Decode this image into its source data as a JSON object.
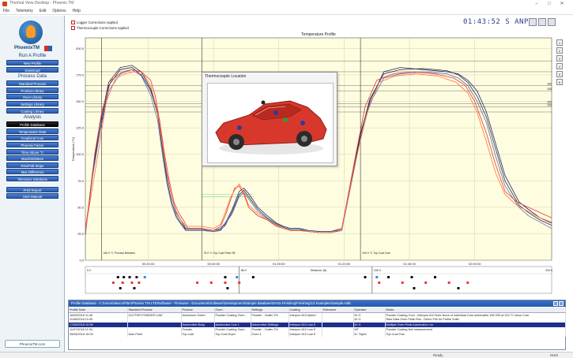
{
  "window": {
    "title": "Thermal View Desktop - Phoenix TM"
  },
  "menu": [
    "File",
    "Telemetry",
    "Edit",
    "Options",
    "Help"
  ],
  "sidebar": {
    "brand": "PhoenixTM",
    "sections": [
      {
        "head": "Run A Profile",
        "items": [
          "New Profile",
          "Download"
        ]
      },
      {
        "head": "Process Data",
        "items": [
          "Standard Process",
          "Product Library",
          "Oven Library",
          "Settings Library",
          "Coating Library"
        ]
      },
      {
        "head": "Analysis",
        "items": [
          "Profile Database",
          "Temperature Data",
          "Graphical Cure",
          "Phoenix Factor",
          "Time Above °C",
          "Max/Min/Mean",
          "Rise/Fall Slope",
          "Max Difference",
          "Tolerance Database"
        ]
      },
      {
        "head": "",
        "items": [
          "Print Report",
          "User Manual"
        ]
      }
    ],
    "active_item": "Profile Database",
    "site_button": "PhoenixTM.com"
  },
  "chart_header": {
    "legend_items": [
      "Logger Corrections Applied",
      "Thermocouple Corrections Applied"
    ],
    "clock": "01:43:52 S ANPC"
  },
  "side_tools": [
    "1",
    "2",
    "3",
    "4",
    "5",
    "6"
  ],
  "popup": {
    "title": "Thermocouple Location"
  },
  "chart_data": {
    "type": "line",
    "title": "Temperature Profile",
    "xlabel": "Time (HH:MM:SS)",
    "ylabel": "Temperature (°C)",
    "ylim": [
      0,
      210
    ],
    "yticks": [
      0,
      25,
      50,
      75,
      100,
      125,
      150,
      175,
      200
    ],
    "yticklabels": [
      "0.0",
      "25.0",
      "50.0",
      "75.0",
      "100.0",
      "125.0",
      "150.0",
      "175.0",
      "200.0"
    ],
    "xlim": [
      0,
      200
    ],
    "xticklabels": [
      {
        "x": 27,
        "label": "00:20:00"
      },
      {
        "x": 55,
        "label": "00:40:00"
      },
      {
        "x": 83,
        "label": "01:00:00"
      },
      {
        "x": 111,
        "label": "01:20:00"
      },
      {
        "x": 139,
        "label": "01:40:00"
      },
      {
        "x": 167,
        "label": "02:00:00"
      }
    ],
    "vertical_markers": [
      {
        "x": 7,
        "label": "180.0 °C\nProcess Between"
      },
      {
        "x": 50,
        "label": "75.0 °C\nTop Coat Peak Off"
      },
      {
        "x": 118,
        "label": "190.0 °C\nTop Coat Cure"
      }
    ],
    "threshold_lines_y": [
      188,
      178,
      165,
      160,
      148,
      145,
      140
    ],
    "right_labels": [
      "180",
      "155",
      "150",
      "140"
    ],
    "green_band_y": [
      62,
      60
    ],
    "grid": true,
    "series": [
      {
        "color": "#1a237e",
        "x": [
          0,
          3,
          6,
          10,
          15,
          20,
          24,
          28,
          31,
          33,
          35,
          37,
          39,
          41,
          43,
          50,
          55,
          58,
          60,
          63,
          66,
          68,
          70,
          74,
          78,
          82,
          85,
          88,
          92,
          96,
          101,
          105,
          110,
          118,
          122,
          128,
          135,
          145,
          155,
          160,
          164,
          168,
          172,
          176,
          180,
          186,
          190,
          195,
          200
        ],
        "y": [
          25,
          80,
          120,
          165,
          180,
          182,
          175,
          160,
          140,
          110,
          80,
          60,
          45,
          38,
          30,
          30,
          28,
          30,
          35,
          48,
          65,
          68,
          63,
          50,
          42,
          35,
          32,
          30,
          30,
          28,
          27,
          27,
          30,
          120,
          150,
          178,
          182,
          180,
          178,
          176,
          170,
          160,
          140,
          110,
          80,
          55,
          48,
          40,
          35
        ]
      },
      {
        "color": "#263238",
        "x": [
          0,
          3,
          6,
          10,
          15,
          20,
          24,
          28,
          31,
          33,
          35,
          37,
          39,
          41,
          43,
          50,
          55,
          58,
          60,
          63,
          66,
          68,
          70,
          74,
          78,
          82,
          85,
          88,
          92,
          96,
          101,
          105,
          110,
          118,
          122,
          128,
          135,
          145,
          155,
          160,
          164,
          168,
          172,
          176,
          180,
          186,
          190,
          195,
          200
        ],
        "y": [
          24,
          82,
          125,
          168,
          182,
          184,
          178,
          162,
          138,
          105,
          75,
          55,
          42,
          35,
          29,
          29,
          27,
          29,
          33,
          46,
          62,
          66,
          60,
          48,
          40,
          34,
          31,
          29,
          29,
          27,
          26,
          26,
          29,
          118,
          152,
          176,
          180,
          181,
          179,
          175,
          168,
          155,
          135,
          105,
          75,
          52,
          45,
          38,
          33
        ]
      },
      {
        "color": "#5c6bc0",
        "x": [
          0,
          3,
          6,
          10,
          15,
          20,
          24,
          28,
          31,
          33,
          35,
          37,
          39,
          41,
          43,
          50,
          55,
          58,
          60,
          63,
          66,
          68,
          70,
          74,
          78,
          82,
          85,
          88,
          92,
          96,
          101,
          105,
          110,
          118,
          122,
          128,
          135,
          145,
          155,
          160,
          164,
          168,
          172,
          176,
          180,
          186,
          190,
          195,
          200
        ],
        "y": [
          25,
          78,
          118,
          160,
          176,
          180,
          174,
          156,
          132,
          100,
          72,
          52,
          40,
          34,
          28,
          28,
          27,
          28,
          34,
          44,
          60,
          64,
          58,
          46,
          39,
          33,
          30,
          28,
          28,
          27,
          26,
          26,
          28,
          115,
          148,
          172,
          176,
          178,
          176,
          172,
          165,
          150,
          130,
          98,
          70,
          50,
          42,
          36,
          30
        ]
      },
      {
        "color": "#e53935",
        "x": [
          0,
          2,
          4,
          7,
          11,
          16,
          20,
          24,
          28,
          30,
          32,
          34,
          36,
          38,
          40,
          42,
          44,
          50,
          55,
          58,
          60,
          62,
          64,
          66,
          68,
          70,
          74,
          78,
          82,
          85,
          88,
          92,
          96,
          101,
          105,
          110,
          116,
          120,
          125,
          132,
          140,
          150,
          158,
          163,
          167,
          172,
          176,
          180,
          185,
          190,
          195,
          200
        ],
        "y": [
          30,
          60,
          100,
          140,
          170,
          178,
          180,
          178,
          170,
          155,
          130,
          100,
          75,
          55,
          45,
          38,
          30,
          30,
          28,
          32,
          42,
          55,
          68,
          70,
          62,
          50,
          42,
          38,
          32,
          30,
          28,
          28,
          27,
          26,
          26,
          30,
          100,
          145,
          170,
          176,
          178,
          176,
          172,
          165,
          150,
          120,
          90,
          65,
          55,
          50,
          45,
          40
        ]
      },
      {
        "color": "#ff7043",
        "x": [
          0,
          2,
          5,
          9,
          13,
          17,
          21,
          25,
          28,
          31,
          33,
          35,
          37,
          39,
          41,
          43,
          50,
          55,
          58,
          60,
          62,
          64,
          66,
          68,
          70,
          74,
          78,
          82,
          85,
          88,
          92,
          96,
          101,
          105,
          110,
          116,
          121,
          126,
          133,
          142,
          151,
          159,
          164,
          168,
          172,
          176,
          180,
          185,
          190,
          195,
          200
        ],
        "y": [
          28,
          55,
          95,
          150,
          172,
          176,
          178,
          175,
          165,
          140,
          110,
          82,
          60,
          46,
          38,
          32,
          32,
          30,
          34,
          45,
          58,
          66,
          72,
          64,
          52,
          44,
          38,
          33,
          30,
          28,
          28,
          27,
          26,
          26,
          29,
          95,
          140,
          168,
          174,
          176,
          174,
          168,
          158,
          140,
          112,
          82,
          62,
          52,
          46,
          40,
          36
        ]
      }
    ]
  },
  "zone_axis": {
    "title": "Distance (ft)",
    "ticks": [
      "0.0",
      "88.0",
      "160.0",
      "200.0"
    ]
  },
  "database": {
    "title": "Profile Database - C:\\Users\\alesco\\Plan\\Phoenix TM LTD\\Software - Firmware - Documents\\Software\\Development\\Sample database\\DH15 Finishing\\Finishing\\12 Examples\\Sample.mdb",
    "columns": [
      "Profile Date",
      "Standard Process",
      "Product",
      "Oven",
      "Settings",
      "Coating",
      "Tolerance",
      "Operator",
      "Notes"
    ],
    "rows": [
      [
        "16/05/2018 11:46",
        "GUTTER POWDER LINE",
        "Aluminium Gutter",
        "Powder Coating Oven",
        "Powder - Gutter 2%",
        "Interpon 610 Alpha+",
        "",
        "Dr G",
        "Powder Coating Cure - Interpon 610 Note None of individual Cure achievable 180 200 at 210 °C show Cure"
      ],
      [
        "11/06/2018 10:30",
        "",
        "",
        "",
        "",
        "",
        "",
        "Dr G",
        "Raw Data Oven Peak Run - Demo File for Profile Suite"
      ],
      [
        "17/06/2018 10:58",
        "",
        "Automotive Body",
        "Automotive Line 1",
        "Automotive Settings",
        "Interpon 610 Low E",
        "",
        "Dr G",
        "Multiple Oven Peak Automotive run"
      ],
      [
        "11/07/2018 11:34",
        "",
        "Powder",
        "Powder Coating Oven",
        "Powder - Gutter 2%",
        "Interpon 610 Low E",
        "",
        "MT",
        "Powder Coating first measurement"
      ],
      [
        "05/06/2018 15:09",
        "Auto Paint",
        "Top coat",
        "Top Coat Dryer",
        "Oven 1",
        "Interpon 610 Low E",
        "",
        "M. Taylor",
        "Top Coat Test"
      ]
    ],
    "selected_row": 2
  },
  "status": {
    "center": "Ready",
    "right": "NUM"
  }
}
